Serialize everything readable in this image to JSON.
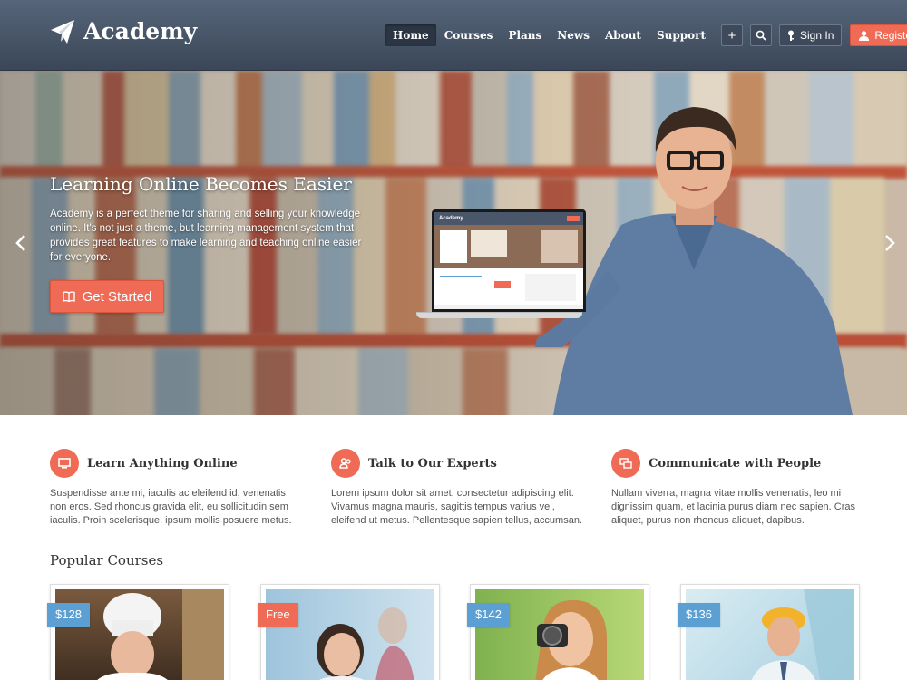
{
  "header": {
    "logo_text": "Academy",
    "nav": [
      "Home",
      "Courses",
      "Plans",
      "News",
      "About",
      "Support"
    ],
    "active_nav": "Home",
    "signin_label": "Sign In",
    "register_label": "Register"
  },
  "hero": {
    "title": "Learning Online Becomes Easier",
    "text": "Academy is a perfect theme for sharing and selling your knowledge online. It's not just a theme, but learning management system that provides great features to make learning and teaching online easier for everyone.",
    "button_label": "Get Started",
    "laptop_logo": "Academy"
  },
  "features": [
    {
      "title": "Learn Anything Online",
      "text": "Suspendisse ante mi, iaculis ac eleifend id, venenatis non eros. Sed rhoncus gravida elit, eu sollicitudin sem iaculis. Proin scelerisque, ipsum mollis posuere metus."
    },
    {
      "title": "Talk to Our Experts",
      "text": "Lorem ipsum dolor sit amet, consectetur adipiscing elit. Vivamus magna mauris, sagittis tempus varius vel, eleifend ut metus. Pellentesque sapien tellus, accumsan."
    },
    {
      "title": "Communicate with People",
      "text": "Nullam viverra, magna vitae mollis venenatis, leo mi dignissim quam, et lacinia purus diam nec sapien. Cras aliquet, purus non rhoncus aliquet, dapibus."
    }
  ],
  "popular": {
    "title": "Popular Courses",
    "courses": [
      {
        "price": "$128",
        "color": "#5b9fd3"
      },
      {
        "price": "Free",
        "color": "#ef6b55"
      },
      {
        "price": "$142",
        "color": "#5b9fd3"
      },
      {
        "price": "$136",
        "color": "#5b9fd3"
      }
    ]
  },
  "colors": {
    "accent": "#ef6b55",
    "header": "#4a5669",
    "price_blue": "#5b9fd3"
  }
}
